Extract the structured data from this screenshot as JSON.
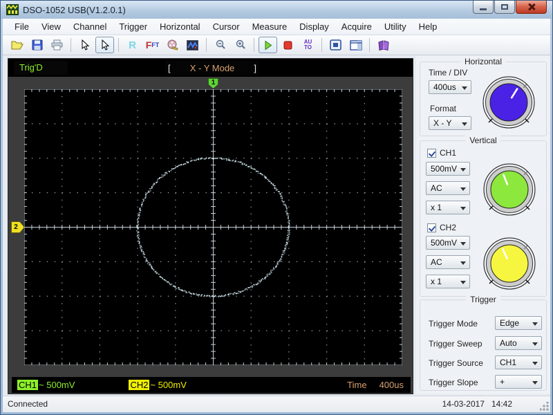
{
  "window": {
    "title": "DSO-1052 USB(V1.2.0.1)"
  },
  "menu": {
    "items": [
      "File",
      "View",
      "Channel",
      "Trigger",
      "Horizontal",
      "Cursor",
      "Measure",
      "Display",
      "Acquire",
      "Utility",
      "Help"
    ]
  },
  "toolbar": {
    "glyphs": {
      "r": "R",
      "fft_f": "F",
      "fft_sub": "FT",
      "auto_top": "AU",
      "auto_bottom": "TO"
    }
  },
  "scope": {
    "status": "Trig'D",
    "mode": "X - Y Mode",
    "bracket_left": "[",
    "bracket_right": "]",
    "markers": {
      "ch1": "1",
      "ch2": "2"
    },
    "grid": {
      "cols": 10,
      "rows": 8,
      "minor_per_div": 5,
      "color": "#96a2ae",
      "center_color": "#c6d0da",
      "border_color": "#b4bcc4",
      "bg": "#000000"
    },
    "trace": {
      "type": "xy-ellipse",
      "color": "#d6eef4",
      "center_div_x": 0,
      "center_div_y": 0,
      "rx_div": 2,
      "ry_div": 2,
      "points": 540,
      "jitter": 2.6
    },
    "footer": {
      "ch1_label": "CH1",
      "ch1_wave": "~",
      "ch1_value": "500mV",
      "ch1_color": "#8cf028",
      "ch2_label": "CH2",
      "ch2_wave": "~",
      "ch2_value": "500mV",
      "ch2_color": "#f0f000",
      "time_label": "Time",
      "time_value": "400us",
      "time_color": "#d8a070"
    }
  },
  "controls": {
    "horizontal": {
      "title": "Horizontal",
      "time_div_label": "Time / DIV",
      "time_div_value": "400us",
      "format_label": "Format",
      "format_value": "X - Y",
      "knob": {
        "color": "#4a22e6",
        "angle": 32
      }
    },
    "vertical": {
      "title": "Vertical",
      "ch1": {
        "label": "CH1",
        "checked": true,
        "volt": "500mV",
        "coupling": "AC",
        "probe": "x 1",
        "knob": {
          "color": "#8ce83c",
          "angle": -22
        }
      },
      "ch2": {
        "label": "CH2",
        "checked": true,
        "volt": "500mV",
        "coupling": "AC",
        "probe": "x 1",
        "knob": {
          "color": "#f6f640",
          "angle": -25
        }
      }
    },
    "trigger": {
      "title": "Trigger",
      "rows": [
        {
          "label": "Trigger Mode",
          "value": "Edge"
        },
        {
          "label": "Trigger Sweep",
          "value": "Auto"
        },
        {
          "label": "Trigger Source",
          "value": "CH1"
        },
        {
          "label": "Trigger Slope",
          "value": "+"
        }
      ]
    }
  },
  "statusbar": {
    "connection": "Connected",
    "date": "14-03-2017",
    "time": "14:42"
  }
}
